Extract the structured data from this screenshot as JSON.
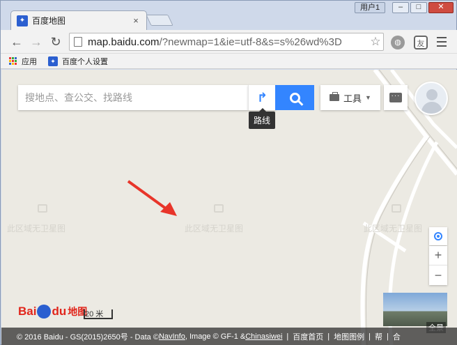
{
  "window": {
    "tab_title": "百度地图",
    "tab_close": "×",
    "user_label": "用户1",
    "min": "–",
    "max": "□",
    "close": "✕"
  },
  "toolbar": {
    "url_host": "map.baidu.com",
    "url_rest": "/?newmap=1&ie=utf-8&s=s%26wd%3D",
    "back": "←",
    "forward": "→",
    "reload": "↻",
    "star": "☆",
    "shield_label": "友"
  },
  "bookmarks": [
    {
      "label": "应用",
      "icon": "apps-icon"
    },
    {
      "label": "百度个人设置",
      "icon": "paw-icon"
    }
  ],
  "map": {
    "search_placeholder": "搜地点、查公交、找路线",
    "route_tooltip": "路线",
    "tools_label": "工具",
    "watermark": "此区域无卫星图",
    "scale_label": "20 米",
    "logo_bai": "Bai",
    "logo_du": "du",
    "logo_map": "地图",
    "photo_label": "全景",
    "zoom_in": "+",
    "zoom_out": "−",
    "copyright": {
      "prefix": "© 2016 Baidu - GS(2015)2650号 - Data © ",
      "navinfo": "NavInfo",
      "mid": " , Image © GF-1 & ",
      "chinasiwei": "Chinasiwei",
      "home": "百度首页",
      "legend": "地图图例",
      "help": "帮",
      "tail": "合"
    }
  },
  "colors": {
    "accent": "#3385ff",
    "map_bg": "#eceae3",
    "arrow": "#e8352a"
  }
}
